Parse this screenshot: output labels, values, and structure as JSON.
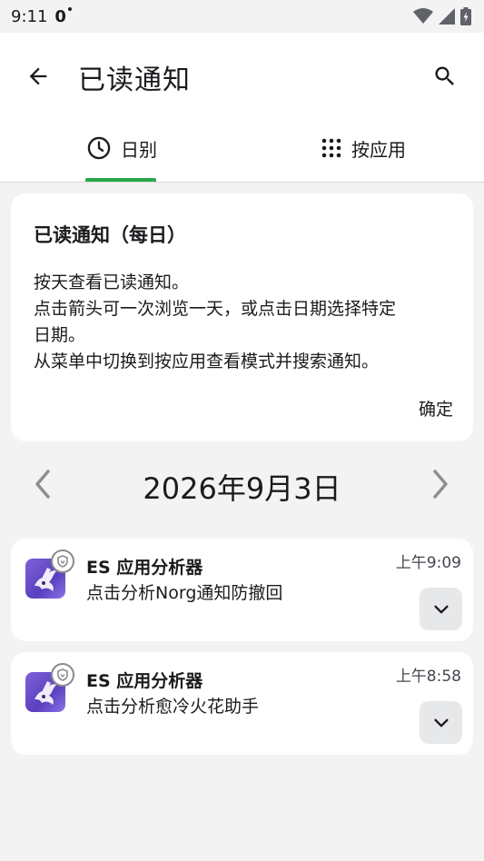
{
  "status_bar": {
    "time": "9:11",
    "indicator": "0"
  },
  "header": {
    "title": "已读通知",
    "back_icon": "arrow-left-icon",
    "search_icon": "search-icon"
  },
  "tabs": [
    {
      "label": "日别",
      "icon": "clock-icon",
      "selected": true
    },
    {
      "label": "按应用",
      "icon": "grid-icon",
      "selected": false
    }
  ],
  "accent_color": "#2aa84a",
  "info_card": {
    "title": "已读通知（每日）",
    "lines": [
      "按天查看已读通知。",
      "点击箭头可一次浏览一天，或点击日期选择特定",
      "日期。",
      "从菜单中切换到按应用查看模式并搜索通知。"
    ],
    "ok_label": "确定"
  },
  "date_nav": {
    "date": "2026年9月3日"
  },
  "notifications": [
    {
      "app": "ES 应用分析器",
      "text": "点击分析Norg通知防撤回",
      "time": "上午9:09"
    },
    {
      "app": "ES 应用分析器",
      "text": "点击分析愈冷火花助手",
      "time": "上午8:58"
    }
  ]
}
